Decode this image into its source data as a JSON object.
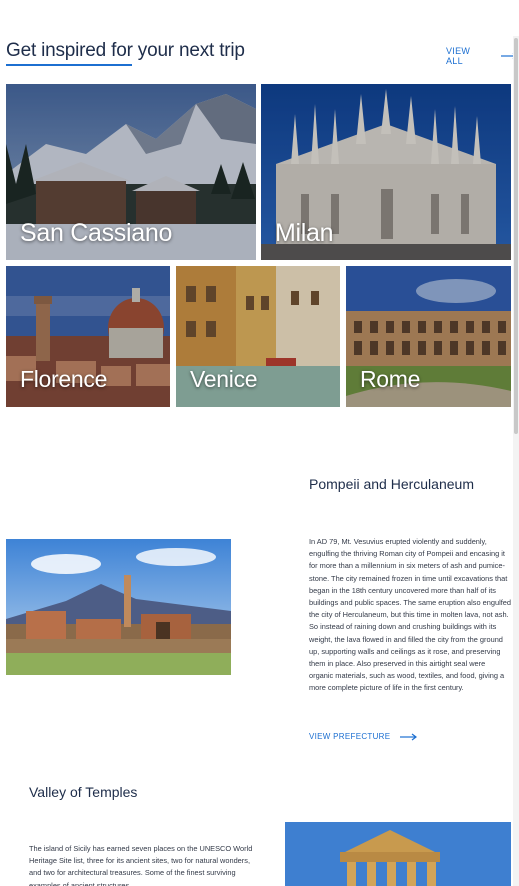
{
  "header": {
    "title": "Get inspired for your next trip",
    "view_all": "VIEW ALL"
  },
  "destinations": [
    {
      "name": "San Cassiano"
    },
    {
      "name": "Milan"
    },
    {
      "name": "Florence"
    },
    {
      "name": "Venice"
    },
    {
      "name": "Rome"
    }
  ],
  "articles": [
    {
      "title": "Pompeii and Herculaneum",
      "body": "In AD 79, Mt. Vesuvius erupted violently and suddenly, engulfing the thriving Roman city of Pompeii and encasing it for more than a millennium in six meters of ash and pumice-stone. The city remained frozen in time until excavations that began in the 18th century uncovered more than half of its buildings and public spaces. The same eruption also engulfed the city of Herculaneum, but this time in molten lava, not ash. So instead of raining down and crushing buildings with its weight, the lava flowed in and filled the city from the ground up, supporting walls and ceilings as it rose, and preserving them in place. Also preserved in this airtight seal were organic materials, such as wood, textiles, and food, giving a more complete picture of life in the first century.",
      "cta": "VIEW PREFECTURE"
    },
    {
      "title": "Valley of Temples",
      "body": "The island of Sicily has earned seven places on the UNESCO World Heritage Site list, three for its ancient sites, two for natural wonders, and two for architectural treasures. Some of the finest surviving examples of ancient structures"
    }
  ],
  "colors": {
    "accent": "#1c6fd1",
    "heading": "#1e2d4a"
  }
}
